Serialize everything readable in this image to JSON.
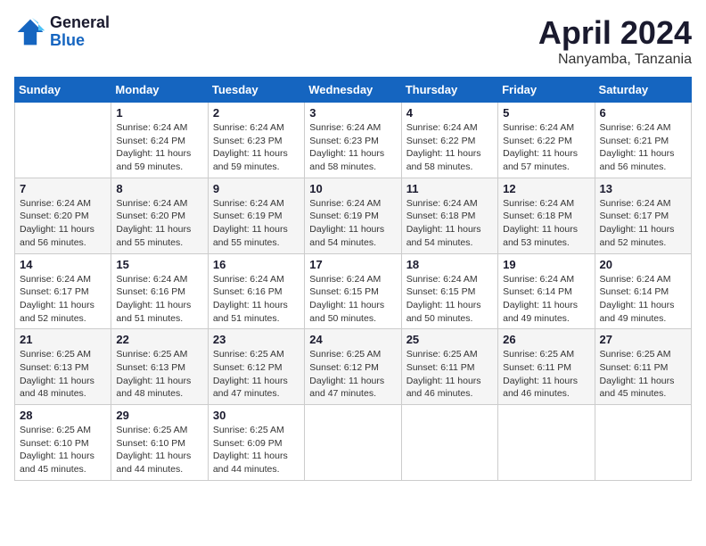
{
  "header": {
    "logo_line1": "General",
    "logo_line2": "Blue",
    "month": "April 2024",
    "location": "Nanyamba, Tanzania"
  },
  "weekdays": [
    "Sunday",
    "Monday",
    "Tuesday",
    "Wednesday",
    "Thursday",
    "Friday",
    "Saturday"
  ],
  "weeks": [
    [
      {
        "day": "",
        "info": ""
      },
      {
        "day": "1",
        "info": "Sunrise: 6:24 AM\nSunset: 6:24 PM\nDaylight: 11 hours\nand 59 minutes."
      },
      {
        "day": "2",
        "info": "Sunrise: 6:24 AM\nSunset: 6:23 PM\nDaylight: 11 hours\nand 59 minutes."
      },
      {
        "day": "3",
        "info": "Sunrise: 6:24 AM\nSunset: 6:23 PM\nDaylight: 11 hours\nand 58 minutes."
      },
      {
        "day": "4",
        "info": "Sunrise: 6:24 AM\nSunset: 6:22 PM\nDaylight: 11 hours\nand 58 minutes."
      },
      {
        "day": "5",
        "info": "Sunrise: 6:24 AM\nSunset: 6:22 PM\nDaylight: 11 hours\nand 57 minutes."
      },
      {
        "day": "6",
        "info": "Sunrise: 6:24 AM\nSunset: 6:21 PM\nDaylight: 11 hours\nand 56 minutes."
      }
    ],
    [
      {
        "day": "7",
        "info": "Sunrise: 6:24 AM\nSunset: 6:20 PM\nDaylight: 11 hours\nand 56 minutes."
      },
      {
        "day": "8",
        "info": "Sunrise: 6:24 AM\nSunset: 6:20 PM\nDaylight: 11 hours\nand 55 minutes."
      },
      {
        "day": "9",
        "info": "Sunrise: 6:24 AM\nSunset: 6:19 PM\nDaylight: 11 hours\nand 55 minutes."
      },
      {
        "day": "10",
        "info": "Sunrise: 6:24 AM\nSunset: 6:19 PM\nDaylight: 11 hours\nand 54 minutes."
      },
      {
        "day": "11",
        "info": "Sunrise: 6:24 AM\nSunset: 6:18 PM\nDaylight: 11 hours\nand 54 minutes."
      },
      {
        "day": "12",
        "info": "Sunrise: 6:24 AM\nSunset: 6:18 PM\nDaylight: 11 hours\nand 53 minutes."
      },
      {
        "day": "13",
        "info": "Sunrise: 6:24 AM\nSunset: 6:17 PM\nDaylight: 11 hours\nand 52 minutes."
      }
    ],
    [
      {
        "day": "14",
        "info": "Sunrise: 6:24 AM\nSunset: 6:17 PM\nDaylight: 11 hours\nand 52 minutes."
      },
      {
        "day": "15",
        "info": "Sunrise: 6:24 AM\nSunset: 6:16 PM\nDaylight: 11 hours\nand 51 minutes."
      },
      {
        "day": "16",
        "info": "Sunrise: 6:24 AM\nSunset: 6:16 PM\nDaylight: 11 hours\nand 51 minutes."
      },
      {
        "day": "17",
        "info": "Sunrise: 6:24 AM\nSunset: 6:15 PM\nDaylight: 11 hours\nand 50 minutes."
      },
      {
        "day": "18",
        "info": "Sunrise: 6:24 AM\nSunset: 6:15 PM\nDaylight: 11 hours\nand 50 minutes."
      },
      {
        "day": "19",
        "info": "Sunrise: 6:24 AM\nSunset: 6:14 PM\nDaylight: 11 hours\nand 49 minutes."
      },
      {
        "day": "20",
        "info": "Sunrise: 6:24 AM\nSunset: 6:14 PM\nDaylight: 11 hours\nand 49 minutes."
      }
    ],
    [
      {
        "day": "21",
        "info": "Sunrise: 6:25 AM\nSunset: 6:13 PM\nDaylight: 11 hours\nand 48 minutes."
      },
      {
        "day": "22",
        "info": "Sunrise: 6:25 AM\nSunset: 6:13 PM\nDaylight: 11 hours\nand 48 minutes."
      },
      {
        "day": "23",
        "info": "Sunrise: 6:25 AM\nSunset: 6:12 PM\nDaylight: 11 hours\nand 47 minutes."
      },
      {
        "day": "24",
        "info": "Sunrise: 6:25 AM\nSunset: 6:12 PM\nDaylight: 11 hours\nand 47 minutes."
      },
      {
        "day": "25",
        "info": "Sunrise: 6:25 AM\nSunset: 6:11 PM\nDaylight: 11 hours\nand 46 minutes."
      },
      {
        "day": "26",
        "info": "Sunrise: 6:25 AM\nSunset: 6:11 PM\nDaylight: 11 hours\nand 46 minutes."
      },
      {
        "day": "27",
        "info": "Sunrise: 6:25 AM\nSunset: 6:11 PM\nDaylight: 11 hours\nand 45 minutes."
      }
    ],
    [
      {
        "day": "28",
        "info": "Sunrise: 6:25 AM\nSunset: 6:10 PM\nDaylight: 11 hours\nand 45 minutes."
      },
      {
        "day": "29",
        "info": "Sunrise: 6:25 AM\nSunset: 6:10 PM\nDaylight: 11 hours\nand 44 minutes."
      },
      {
        "day": "30",
        "info": "Sunrise: 6:25 AM\nSunset: 6:09 PM\nDaylight: 11 hours\nand 44 minutes."
      },
      {
        "day": "",
        "info": ""
      },
      {
        "day": "",
        "info": ""
      },
      {
        "day": "",
        "info": ""
      },
      {
        "day": "",
        "info": ""
      }
    ]
  ]
}
